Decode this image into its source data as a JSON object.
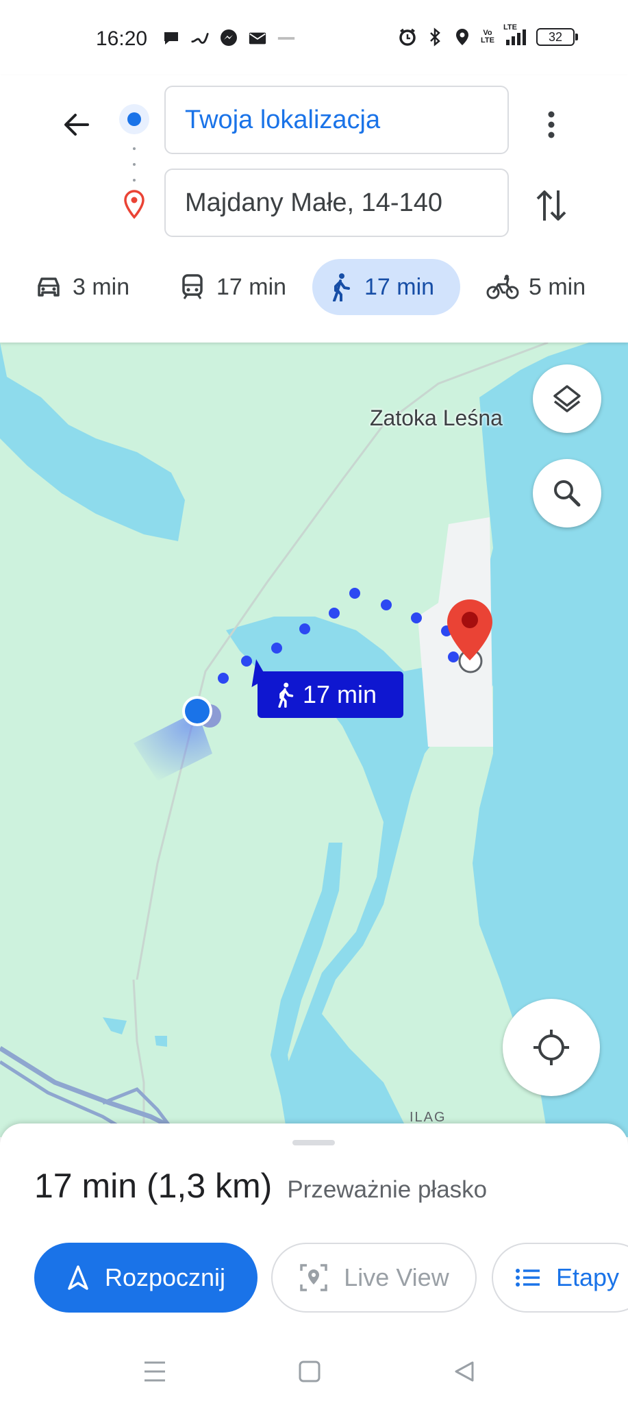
{
  "status_bar": {
    "time": "16:20",
    "left_icons": [
      "chat-bubble-icon",
      "swirl-icon",
      "messenger-icon",
      "mail-icon",
      "small-app-icon"
    ],
    "right_icons": [
      "alarm-icon",
      "bluetooth-icon",
      "location-icon",
      "volte-icon",
      "lte-signal-icon"
    ],
    "volte_text": "Vo LTE",
    "lte_text": "LTE",
    "battery": "32"
  },
  "search": {
    "origin": "Twoja lokalizacja",
    "destination": "Majdany Małe, 14-140"
  },
  "modes": [
    {
      "icon": "car-icon",
      "label": "3 min"
    },
    {
      "icon": "train-icon",
      "label": "17 min"
    },
    {
      "icon": "walk-icon",
      "label": "17 min",
      "active": true
    },
    {
      "icon": "bike-icon",
      "label": "5 min"
    }
  ],
  "map": {
    "place_label": "Zatoka Leśna",
    "ilag_label": "ILAG",
    "route_time": "17 min",
    "colors": {
      "land": "#cdf2dd",
      "water": "#8edbec",
      "route": "#2c48f2",
      "pin": "#ea4335"
    }
  },
  "sheet": {
    "duration": "17 min (1,3 km)",
    "terrain": "Przeważnie płasko",
    "start_label": "Rozpocznij",
    "live_view_label": "Live View",
    "steps_label": "Etapy"
  },
  "accent_color": "#1a73e8"
}
